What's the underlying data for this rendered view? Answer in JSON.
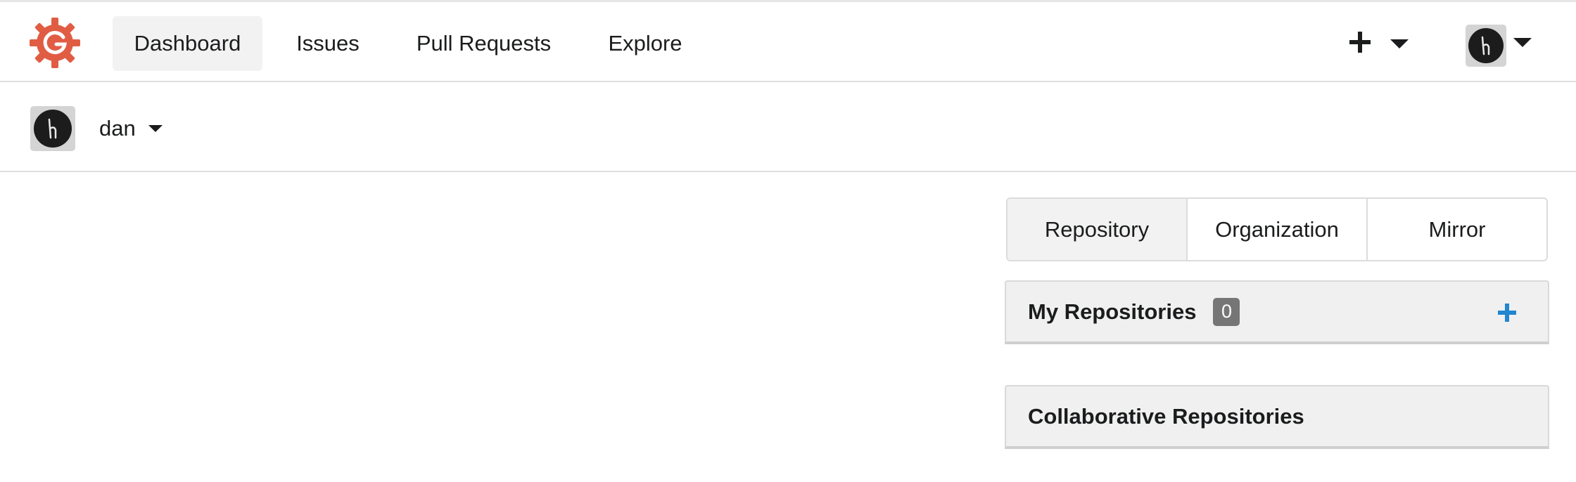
{
  "brand": {
    "accent": "#e05d44",
    "logo_icon": "gitea-logo-icon"
  },
  "nav": {
    "items": [
      {
        "label": "Dashboard",
        "active": true
      },
      {
        "label": "Issues",
        "active": false
      },
      {
        "label": "Pull Requests",
        "active": false
      },
      {
        "label": "Explore",
        "active": false
      }
    ],
    "create_icon": "plus-icon",
    "user_icon": "avatar"
  },
  "context": {
    "name": "dan"
  },
  "repo_tabs": [
    {
      "label": "Repository",
      "active": true
    },
    {
      "label": "Organization",
      "active": false
    },
    {
      "label": "Mirror",
      "active": false
    }
  ],
  "my_repos": {
    "title": "My Repositories",
    "count": "0",
    "add_color": "#2185d0"
  },
  "collab_repos": {
    "title": "Collaborative Repositories"
  }
}
